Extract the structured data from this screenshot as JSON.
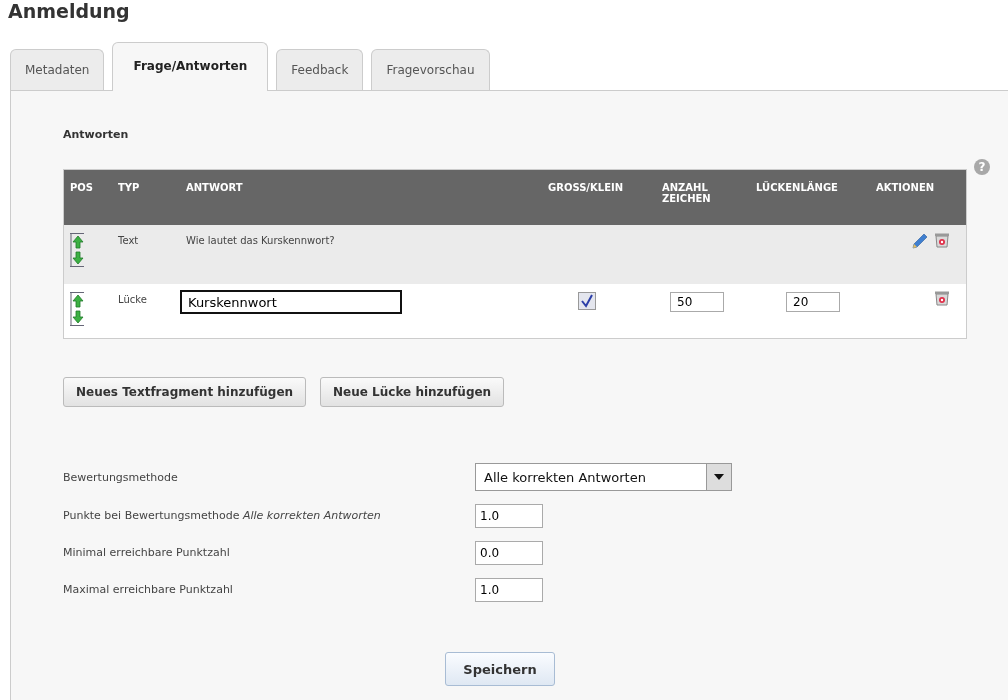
{
  "page_title": "Anmeldung",
  "tabs": [
    {
      "label": "Metadaten",
      "selected": false
    },
    {
      "label": "Frage/Antworten",
      "selected": true
    },
    {
      "label": "Feedback",
      "selected": false
    },
    {
      "label": "Fragevorschau",
      "selected": false
    }
  ],
  "section_title": "Antworten",
  "help_icon": "?",
  "table": {
    "columns": [
      "POS",
      "TYP",
      "ANTWORT",
      "GROSS/KLEIN",
      "ANZAHL ZEICHEN",
      "LÜCKENLÄNGE",
      "AKTIONEN"
    ],
    "rows": [
      {
        "kind": "text",
        "type": "Text",
        "answer": "Wie lautet das Kurskennwort?",
        "editable": true
      },
      {
        "kind": "gap",
        "type": "Lücke",
        "answer": "Kurskennwort",
        "case_sensitive": true,
        "char_count": "50",
        "gap_length": "20",
        "editable": false
      }
    ]
  },
  "add_buttons": [
    "Neues Textfragment hinzufügen",
    "Neue Lücke hinzufügen"
  ],
  "form": [
    {
      "kind": "select",
      "label": "Bewertungsmethode",
      "value": "Alle korrekten Antworten"
    },
    {
      "kind": "input",
      "label": "Punkte bei Bewertungsmethode *Alle korrekten Antworten*",
      "value": "1.0"
    },
    {
      "kind": "input",
      "label": "Minimal erreichbare Punktzahl",
      "value": "0.0"
    },
    {
      "kind": "input",
      "label": "Maximal erreichbare Punktzahl",
      "value": "1.0"
    }
  ],
  "save_button": "Speichern"
}
